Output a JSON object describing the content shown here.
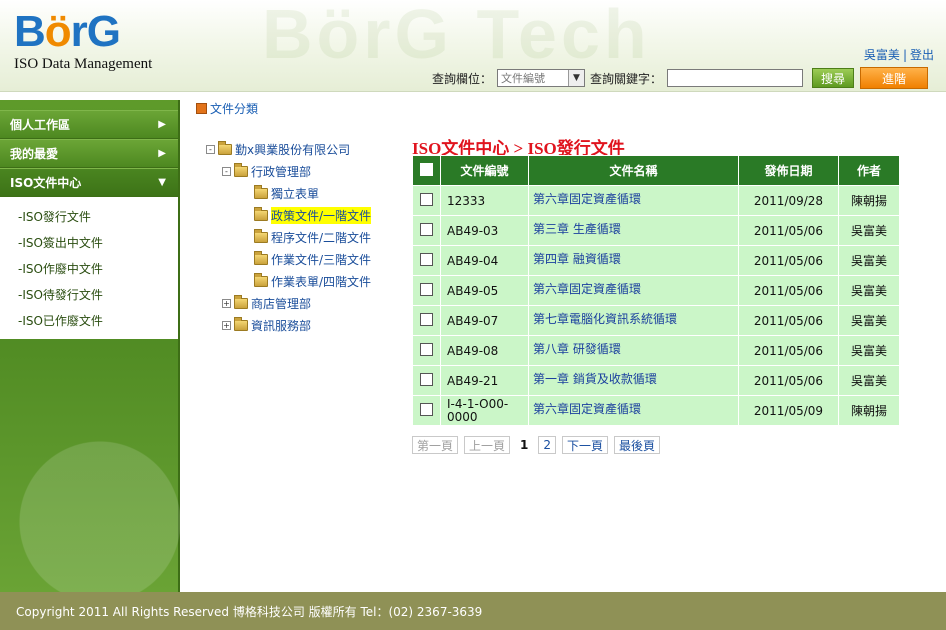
{
  "header": {
    "logo_text_a": "B",
    "logo_text_o": "ö",
    "logo_text_b": "rG",
    "logo_subtitle": "ISO Data Management",
    "watermark": "BörG Tech",
    "user_name": "吳富美",
    "separator": "|",
    "logout_label": "登出"
  },
  "search": {
    "field_label": "查詢欄位：",
    "field_selected": "文件編號",
    "keyword_label": "查詢關鍵字：",
    "keyword_value": "",
    "search_button": "搜尋",
    "advanced_button": "進階"
  },
  "sidebar": {
    "menu": [
      {
        "label": "個人工作區",
        "icon": "triangle-right"
      },
      {
        "label": "我的最愛",
        "icon": "triangle-right"
      },
      {
        "label": "ISO文件中心",
        "icon": "triangle-down"
      }
    ],
    "submenu": [
      "-ISO發行文件",
      "-ISO簽出中文件",
      "-ISO作廢中文件",
      "-ISO待發行文件",
      "-ISO已作廢文件"
    ]
  },
  "category": {
    "title": "文件分類",
    "tree": [
      {
        "label": "勤x興業股份有限公司",
        "toggle": "-"
      },
      {
        "label": "行政管理部",
        "toggle": "-"
      },
      {
        "label": "獨立表單",
        "toggle": ""
      },
      {
        "label": "政策文件/一階文件",
        "toggle": ""
      },
      {
        "label": "程序文件/二階文件",
        "toggle": ""
      },
      {
        "label": "作業文件/三階文件",
        "toggle": ""
      },
      {
        "label": "作業表單/四階文件",
        "toggle": ""
      },
      {
        "label": "商店管理部",
        "toggle": "+"
      },
      {
        "label": "資訊服務部",
        "toggle": "+"
      }
    ]
  },
  "content": {
    "title": "ISO文件中心 > ISO發行文件",
    "columns": [
      "文件編號",
      "文件名稱",
      "發佈日期",
      "作者"
    ],
    "rows": [
      {
        "code": "12333",
        "name": "第六章固定資產循環",
        "date": "2011/09/28",
        "author": "陳朝揚"
      },
      {
        "code": "AB49-03",
        "name": "第三章 生產循環",
        "date": "2011/05/06",
        "author": "吳富美"
      },
      {
        "code": "AB49-04",
        "name": "第四章 融資循環",
        "date": "2011/05/06",
        "author": "吳富美"
      },
      {
        "code": "AB49-05",
        "name": "第六章固定資產循環",
        "date": "2011/05/06",
        "author": "吳富美"
      },
      {
        "code": "AB49-07",
        "name": "第七章電腦化資訊系統循環",
        "date": "2011/05/06",
        "author": "吳富美"
      },
      {
        "code": "AB49-08",
        "name": "第八章 研發循環",
        "date": "2011/05/06",
        "author": "吳富美"
      },
      {
        "code": "AB49-21",
        "name": "第一章 銷貨及收款循環",
        "date": "2011/05/06",
        "author": "吳富美"
      },
      {
        "code": "I-4-1-O00-0000",
        "name": "第六章固定資產循環",
        "date": "2011/05/09",
        "author": "陳朝揚"
      }
    ]
  },
  "pager": {
    "first": "第一頁",
    "prev": "上一頁",
    "page1": "1",
    "page2": "2",
    "next": "下一頁",
    "last": "最後頁"
  },
  "footer": {
    "text": "Copyright 2011 All Rights Reserved 博格科技公司 版權所有 Tel：(02) 2367-3639"
  },
  "colors": {
    "brand_blue": "#1f73c2",
    "brand_orange": "#f08a00",
    "sidebar_green": "#4f8a22",
    "table_header": "#2a7a26",
    "row_bg": "#cbf6c8",
    "title_red": "#e0141e",
    "footer_olive": "#8f9156"
  }
}
